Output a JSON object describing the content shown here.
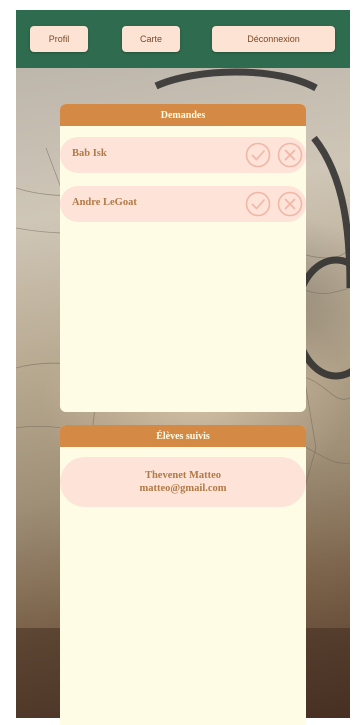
{
  "nav": {
    "profile_label": "Profil",
    "map_label": "Carte",
    "logout_label": "Déconnexion"
  },
  "requests": {
    "title": "Demandes",
    "items": [
      {
        "name": "Bab Isk"
      },
      {
        "name": "Andre LeGoat"
      }
    ]
  },
  "students": {
    "title": "Élèves suivis",
    "items": [
      {
        "name": "Thevenet Matteo",
        "email": "matteo@gmail.com"
      }
    ]
  },
  "colors": {
    "topbar": "#2f6b4e",
    "button_bg": "#fde3d3",
    "panel_header": "#d48a44",
    "panel_bg": "#fffce6",
    "text_accent": "#b27a46",
    "icon_stroke": "#f2b6a6"
  },
  "icons": [
    "checkmark-circle-icon",
    "close-circle-icon"
  ]
}
